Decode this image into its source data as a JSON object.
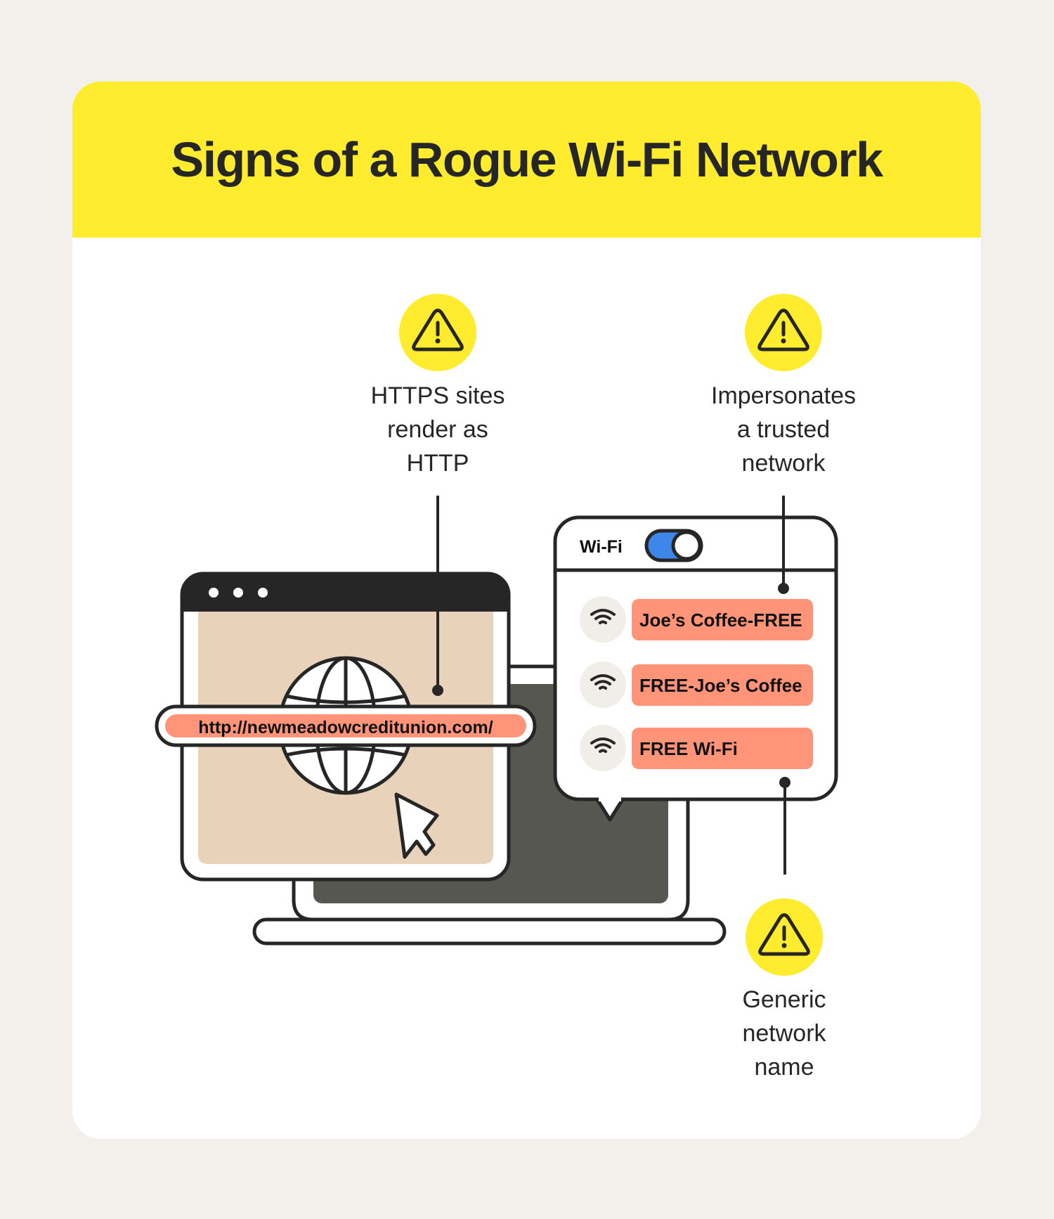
{
  "title": "Signs of a Rogue Wi-Fi Network",
  "colors": {
    "background": "#f3f0eb",
    "header_yellow": "#ffec2e",
    "ink": "#262626",
    "salmon": "#ff9478",
    "beige": "#e8d2b9",
    "screen_dark": "#575752",
    "toggle_blue": "#3e86ea",
    "icon_bg": "#f1eee9"
  },
  "callouts": [
    {
      "icon": "warning-triangle-icon",
      "lines": [
        "HTTPS sites",
        "render as",
        "HTTP"
      ]
    },
    {
      "icon": "warning-triangle-icon",
      "lines": [
        "Impersonates",
        "a trusted",
        "network"
      ]
    },
    {
      "icon": "warning-triangle-icon",
      "lines": [
        "Generic",
        "network",
        "name"
      ]
    }
  ],
  "browser": {
    "url": "http://newmeadowcreditunion.com/",
    "window_dots": 3
  },
  "wifi_panel": {
    "label": "Wi-Fi",
    "toggle_on": true,
    "networks": [
      {
        "name": "Joe’s Coffee-FREE",
        "icon": "wifi-icon"
      },
      {
        "name": "FREE-Joe’s Coffee",
        "icon": "wifi-icon"
      },
      {
        "name": "FREE Wi-Fi",
        "icon": "wifi-icon"
      }
    ]
  }
}
